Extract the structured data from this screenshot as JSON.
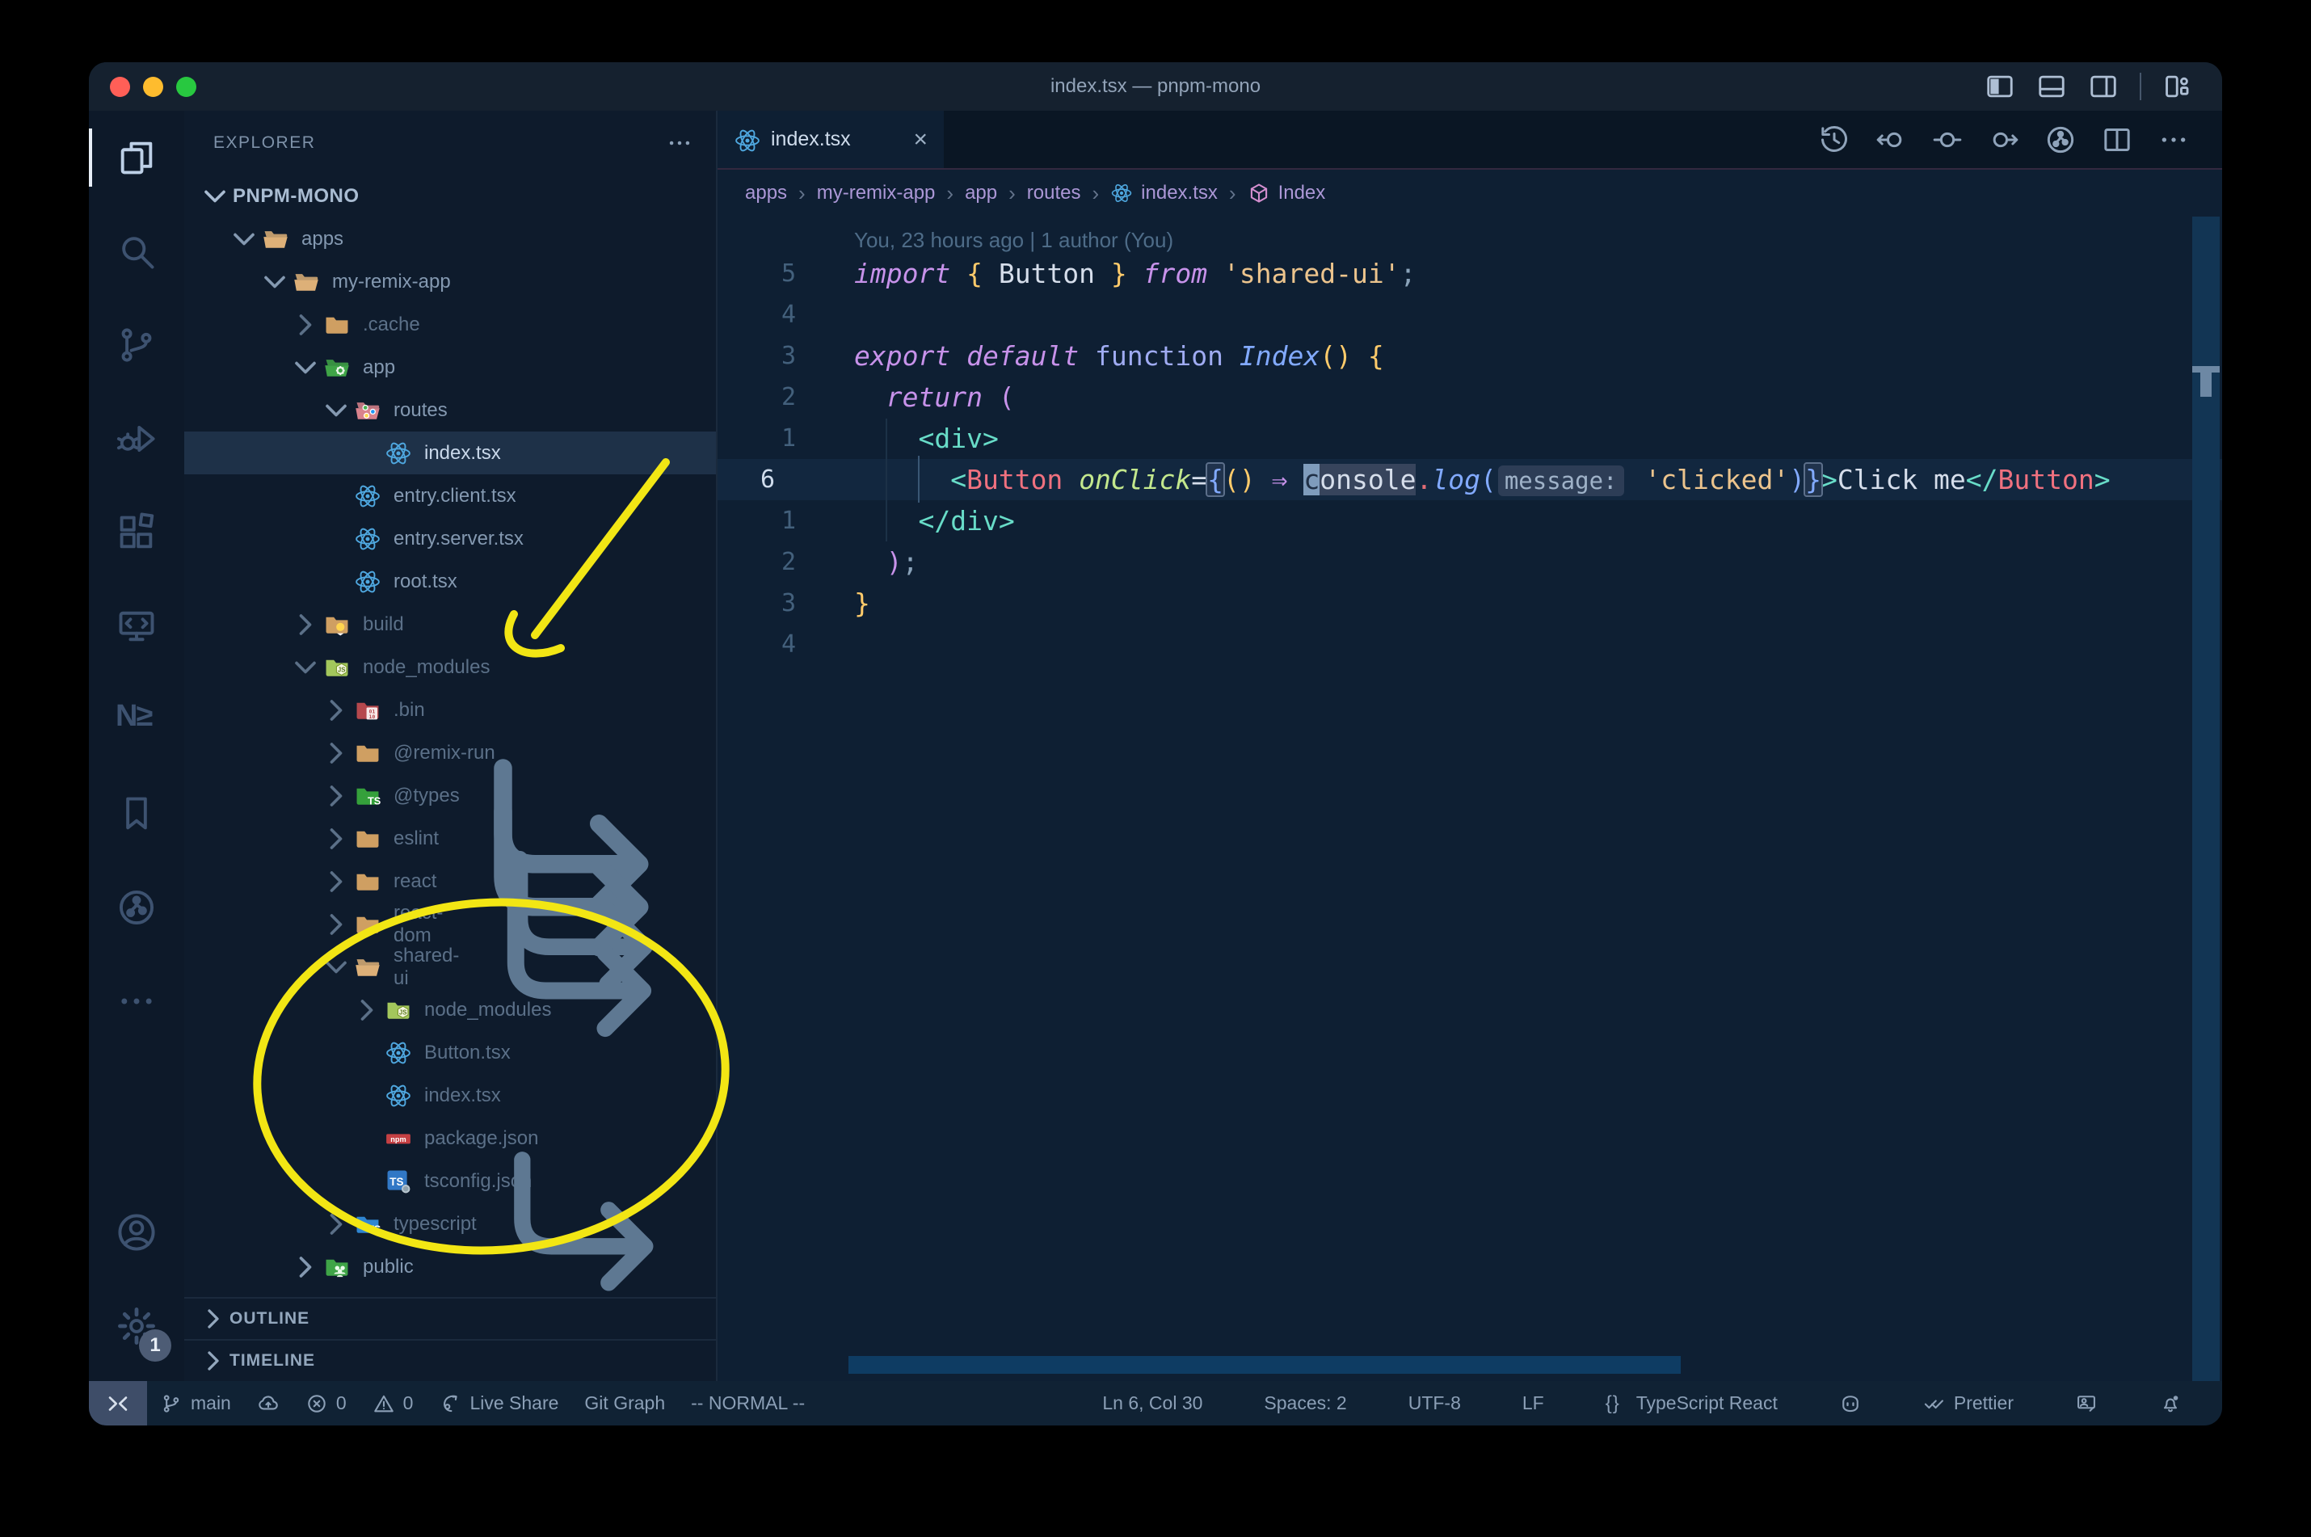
{
  "window": {
    "title": "index.tsx — pnpm-mono",
    "traffic_colors": {
      "close": "#ff5f57",
      "minimize": "#febc2e",
      "zoom": "#28c840"
    },
    "layout_controls": [
      {
        "name": "toggle-primary-sidebar-button",
        "icon": "layout-sidebar-icon"
      },
      {
        "name": "toggle-panel-button",
        "icon": "layout-panel-icon"
      },
      {
        "name": "toggle-secondary-sidebar-button",
        "icon": "layout-sidebar-right-icon"
      },
      {
        "name": "separator",
        "icon": "separator"
      },
      {
        "name": "customize-layout-button",
        "icon": "layout-customize-icon"
      }
    ]
  },
  "activity_bar": {
    "top": [
      {
        "name": "explorer",
        "icon": "files-icon",
        "active": true
      },
      {
        "name": "search",
        "icon": "search-icon"
      },
      {
        "name": "source-control",
        "icon": "source-control-icon"
      },
      {
        "name": "run-and-debug",
        "icon": "debug-icon"
      },
      {
        "name": "extensions",
        "icon": "extensions-icon"
      },
      {
        "name": "remote-explorer",
        "icon": "remote-explorer-icon"
      },
      {
        "name": "nx-console",
        "icon": "nx-icon",
        "text": "N≥"
      },
      {
        "name": "bookmarks",
        "icon": "bookmark-icon"
      },
      {
        "name": "git-graph",
        "icon": "gitgraph-circle-icon"
      },
      {
        "name": "additional-views",
        "icon": "ellipsis-icon"
      }
    ],
    "bottom": [
      {
        "name": "accounts",
        "icon": "account-icon"
      },
      {
        "name": "settings",
        "icon": "gear-icon",
        "badge": "1"
      }
    ]
  },
  "explorer": {
    "header": "EXPLORER",
    "more_icon": "ellipsis-icon",
    "root": "PNPM-MONO",
    "tree": [
      {
        "label": "apps",
        "depth": 0,
        "chevron": "down",
        "icon": "folder-open-tan"
      },
      {
        "label": "my-remix-app",
        "depth": 1,
        "chevron": "down",
        "icon": "folder-open-tan"
      },
      {
        "label": ".cache",
        "depth": 2,
        "chevron": "right",
        "icon": "folder-tan",
        "dim": true
      },
      {
        "label": "app",
        "depth": 2,
        "chevron": "down",
        "icon": "folder-app-green"
      },
      {
        "label": "routes",
        "depth": 3,
        "chevron": "down",
        "icon": "folder-routes-pink"
      },
      {
        "label": "index.tsx",
        "depth": 4,
        "chevron": "none",
        "icon": "react-icon",
        "selected": true
      },
      {
        "label": "entry.client.tsx",
        "depth": 3,
        "chevron": "none",
        "icon": "react-icon"
      },
      {
        "label": "entry.server.tsx",
        "depth": 3,
        "chevron": "none",
        "icon": "react-icon"
      },
      {
        "label": "root.tsx",
        "depth": 3,
        "chevron": "none",
        "icon": "react-icon"
      },
      {
        "label": "build",
        "depth": 2,
        "chevron": "right",
        "icon": "folder-build-tan",
        "dim": true
      },
      {
        "label": "node_modules",
        "depth": 2,
        "chevron": "down",
        "icon": "folder-node-lime",
        "dim": true
      },
      {
        "label": ".bin",
        "depth": 3,
        "chevron": "right",
        "icon": "folder-bin-red",
        "dim": true
      },
      {
        "label": "@remix-run",
        "depth": 3,
        "chevron": "right",
        "icon": "folder-tan",
        "dim": true
      },
      {
        "label": "@types",
        "depth": 3,
        "chevron": "right",
        "icon": "folder-types-green",
        "dim": true
      },
      {
        "label": "eslint",
        "depth": 3,
        "chevron": "right",
        "icon": "folder-tan",
        "dim": true,
        "symlink": true
      },
      {
        "label": "react",
        "depth": 3,
        "chevron": "right",
        "icon": "folder-tan",
        "dim": true,
        "symlink": true
      },
      {
        "label": "react-dom",
        "depth": 3,
        "chevron": "right",
        "icon": "folder-tan",
        "dim": true,
        "symlink": true
      },
      {
        "label": "shared-ui",
        "depth": 3,
        "chevron": "down",
        "icon": "folder-open-tan",
        "dim": true,
        "symlink": true
      },
      {
        "label": "node_modules",
        "depth": 4,
        "chevron": "right",
        "icon": "folder-node-lime",
        "dim": true
      },
      {
        "label": "Button.tsx",
        "depth": 4,
        "chevron": "none",
        "icon": "react-icon",
        "dim": true
      },
      {
        "label": "index.tsx",
        "depth": 4,
        "chevron": "none",
        "icon": "react-icon",
        "dim": true
      },
      {
        "label": "package.json",
        "depth": 4,
        "chevron": "none",
        "icon": "npm-icon",
        "dim": true
      },
      {
        "label": "tsconfig.json",
        "depth": 4,
        "chevron": "none",
        "icon": "tsconfig-icon",
        "dim": true
      },
      {
        "label": "typescript",
        "depth": 3,
        "chevron": "right",
        "icon": "folder-ts-blue",
        "dim": true,
        "symlink": true
      },
      {
        "label": "public",
        "depth": 2,
        "chevron": "right",
        "icon": "folder-public-green"
      }
    ],
    "sections": [
      {
        "label": "OUTLINE"
      },
      {
        "label": "TIMELINE"
      }
    ]
  },
  "editor": {
    "tab": {
      "label": "index.tsx",
      "icon": "react-icon",
      "close": "×"
    },
    "toolbar": [
      {
        "name": "timeline-history-button",
        "icon": "history-icon"
      },
      {
        "name": "nav-back-button",
        "icon": "nav-back-icon"
      },
      {
        "name": "nav-current-button",
        "icon": "nav-dot-icon"
      },
      {
        "name": "nav-forward-button",
        "icon": "nav-forward-icon"
      },
      {
        "name": "git-graph-view-button",
        "icon": "gitgraph-circle-icon"
      },
      {
        "name": "split-editor-button",
        "icon": "split-editor-icon"
      },
      {
        "name": "more-actions-button",
        "icon": "ellipsis-icon"
      }
    ],
    "breadcrumbs": [
      {
        "label": "apps"
      },
      {
        "label": "my-remix-app"
      },
      {
        "label": "app"
      },
      {
        "label": "routes"
      },
      {
        "label": "index.tsx",
        "icon": "react-icon"
      },
      {
        "label": "Index",
        "icon": "symbol-cube-icon"
      }
    ],
    "blame": "You, 23 hours ago | 1 author (You)",
    "lines": [
      {
        "num": "5",
        "tokens": [
          [
            "kw",
            "import"
          ],
          [
            "wh",
            " "
          ],
          [
            "yb",
            "{"
          ],
          [
            "wh",
            " Button "
          ],
          [
            "yb",
            "}"
          ],
          [
            "kw",
            " from"
          ],
          [
            "wh",
            " "
          ],
          [
            "str",
            "'shared-ui'"
          ],
          [
            "pun",
            ";"
          ]
        ]
      },
      {
        "num": "4",
        "tokens": []
      },
      {
        "num": "3",
        "tokens": [
          [
            "kw",
            "export"
          ],
          [
            "wh",
            " "
          ],
          [
            "kw",
            "default"
          ],
          [
            "wh",
            " "
          ],
          [
            "kw2",
            "function"
          ],
          [
            "wh",
            " "
          ],
          [
            "fn",
            "Index"
          ],
          [
            "yb",
            "()"
          ],
          [
            "wh",
            " "
          ],
          [
            "yb",
            "{"
          ]
        ]
      },
      {
        "num": "2",
        "tokens": [
          [
            "wh",
            "  "
          ],
          [
            "kw",
            "return"
          ],
          [
            "mag",
            " ("
          ]
        ]
      },
      {
        "num": "1",
        "tokens": [
          [
            "wh",
            "    "
          ],
          [
            "teal",
            "<div>"
          ]
        ]
      },
      {
        "num": "6",
        "current": true,
        "tokens": [
          [
            "wh",
            "      "
          ],
          [
            "teal",
            "<"
          ],
          [
            "red",
            "Button"
          ],
          [
            "wh",
            " "
          ],
          [
            "grn",
            "onClick"
          ],
          [
            "wh",
            "="
          ],
          [
            "brk",
            "{"
          ],
          [
            "yb",
            "()"
          ],
          [
            "wh",
            " "
          ],
          [
            "mag",
            "⇒"
          ],
          [
            "wh",
            " "
          ],
          [
            "cur",
            "c"
          ],
          [
            "wrd",
            "onsole"
          ],
          [
            "dot",
            "."
          ],
          [
            "fn",
            "log"
          ],
          [
            "blue",
            "("
          ],
          [
            "inl",
            "message:"
          ],
          [
            "wh",
            " "
          ],
          [
            "str",
            "'clicked'"
          ],
          [
            "blue",
            ")"
          ],
          [
            "brk",
            "}"
          ],
          [
            "teal",
            ">"
          ],
          [
            "wh",
            "Click me"
          ],
          [
            "teal",
            "</"
          ],
          [
            "red",
            "Button"
          ],
          [
            "teal",
            ">"
          ]
        ]
      },
      {
        "num": "1",
        "tokens": [
          [
            "wh",
            "    "
          ],
          [
            "teal",
            "</div>"
          ]
        ]
      },
      {
        "num": "2",
        "tokens": [
          [
            "wh",
            "  "
          ],
          [
            "mag",
            ")"
          ],
          [
            "pun",
            ";"
          ]
        ]
      },
      {
        "num": "3",
        "tokens": [
          [
            "yb",
            "}"
          ]
        ]
      },
      {
        "num": "4",
        "tokens": []
      }
    ]
  },
  "status_bar": {
    "left": [
      {
        "name": "remote-indicator",
        "icon": "remote-icon",
        "remote": true
      },
      {
        "name": "git-branch",
        "icon": "branch-icon",
        "label": "main"
      },
      {
        "name": "sync-changes",
        "icon": "cloud-upload-icon"
      },
      {
        "name": "problems-errors",
        "icon": "error-icon",
        "label": "0"
      },
      {
        "name": "problems-warnings",
        "icon": "warning-icon",
        "label": "0"
      },
      {
        "name": "live-share",
        "icon": "liveshare-icon",
        "label": "Live Share"
      },
      {
        "name": "git-graph-status",
        "label": "Git Graph"
      },
      {
        "name": "vim-mode",
        "label": "-- NORMAL --"
      }
    ],
    "right": [
      {
        "name": "cursor-position",
        "label": "Ln 6, Col 30"
      },
      {
        "name": "indentation",
        "label": "Spaces: 2"
      },
      {
        "name": "encoding",
        "label": "UTF-8"
      },
      {
        "name": "eol",
        "label": "LF"
      },
      {
        "name": "language-mode",
        "icon": "braces-icon",
        "label": "TypeScript React"
      },
      {
        "name": "copilot",
        "icon": "copilot-icon"
      },
      {
        "name": "prettier",
        "icon": "prettier-icon",
        "label": "Prettier"
      },
      {
        "name": "feedback",
        "icon": "feedback-icon"
      },
      {
        "name": "notifications",
        "icon": "bell-icon"
      }
    ]
  },
  "annotations": {
    "color": "#f2e614",
    "arrow": "hand-drawn arrow pointing at node_modules",
    "ellipse": "hand-drawn circle around shared-ui package files"
  }
}
